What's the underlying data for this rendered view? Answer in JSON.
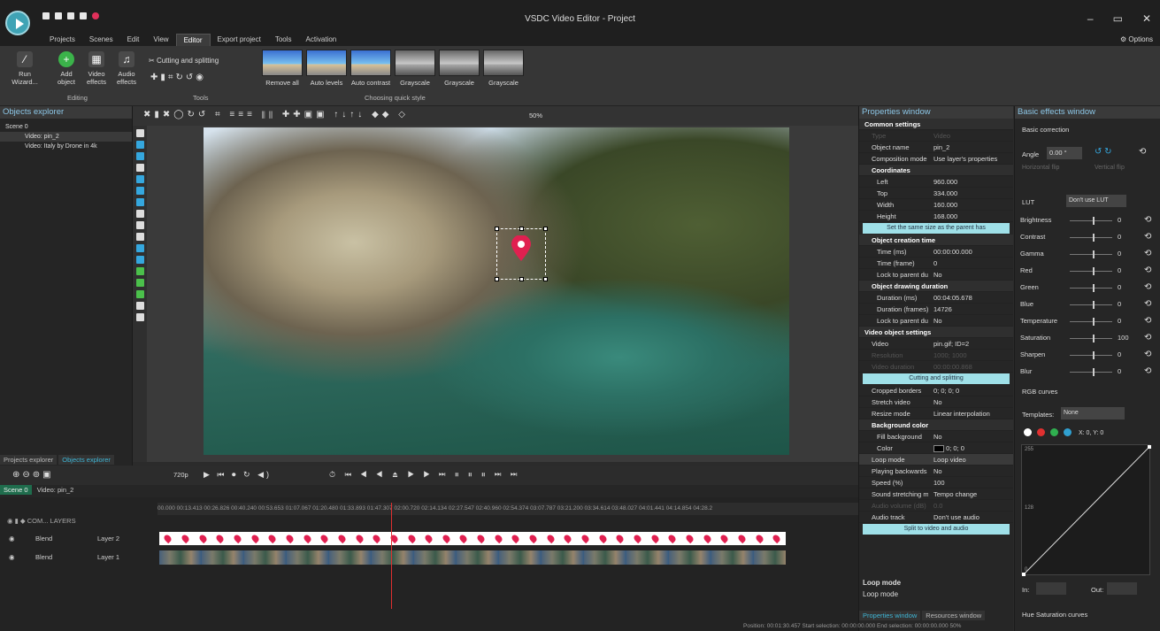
{
  "window": {
    "title": "VSDC Video Editor - Project",
    "options_label": "Options"
  },
  "menu": [
    "Projects",
    "Scenes",
    "Edit",
    "View",
    "Editor",
    "Export project",
    "Tools",
    "Activation"
  ],
  "ribbon": {
    "run_wizard": "Run Wizard...",
    "add_object": "Add object",
    "video_effects": "Video effects",
    "audio_effects": "Audio effects",
    "editing_label": "Editing",
    "cutting_label": "Cutting and splitting",
    "tools_label": "Tools",
    "quick_styles": [
      "Remove all",
      "Auto levels",
      "Auto contrast",
      "Grayscale",
      "Grayscale",
      "Grayscale"
    ],
    "quick_style_label": "Choosing quick style"
  },
  "objects_explorer": {
    "title": "Objects explorer",
    "items": [
      "Scene 0",
      "Video: pin_2",
      "Video: Italy by Drone in 4k"
    ],
    "tabs": [
      "Projects explorer",
      "Objects explorer"
    ]
  },
  "canvas": {
    "zoom": "50%"
  },
  "transport": {
    "resolution": "720p"
  },
  "timeline": {
    "tabs": [
      "Scene 0",
      "Video: pin_2"
    ],
    "header": "COM... LAYERS",
    "ruler": "00.000  00:13.413  00:26.826  00:40.240  00:53.653  01:07.067  01:20.480  01:33.893  01:47.307  02:00.720  02:14.134  02:27.547  02:40.960  02:54.374  03:07.787  03:21.200  03:34.614  03:48.027  04:01.441  04:14.854  04:28.2",
    "layers": [
      {
        "blend": "Blend",
        "name": "Layer 2"
      },
      {
        "blend": "Blend",
        "name": "Layer 1"
      }
    ],
    "pin_markers": 36
  },
  "properties": {
    "title": "Properties window",
    "common": "Common settings",
    "type_k": "Type",
    "type_v": "Video",
    "name_k": "Object name",
    "name_v": "pin_2",
    "comp_k": "Composition mode",
    "comp_v": "Use layer's properties",
    "coords": "Coordinates",
    "left_k": "Left",
    "left_v": "960.000",
    "top_k": "Top",
    "top_v": "334.000",
    "width_k": "Width",
    "width_v": "160.000",
    "height_k": "Height",
    "height_v": "168.000",
    "same_size_btn": "Set the same size as the parent has",
    "creation": "Object creation time",
    "time_ms_k": "Time (ms)",
    "time_ms_v": "00:00:00.000",
    "time_fr_k": "Time (frame)",
    "time_fr_v": "0",
    "lock1_k": "Lock to parent du",
    "lock1_v": "No",
    "drawing": "Object drawing duration",
    "dur_ms_k": "Duration (ms)",
    "dur_ms_v": "00:04:05.678",
    "dur_fr_k": "Duration (frames)",
    "dur_fr_v": "14726",
    "lock2_k": "Lock to parent du",
    "lock2_v": "No",
    "video_settings": "Video object settings",
    "video_k": "Video",
    "video_v": "pin.gif; ID=2",
    "res_k": "Resolution",
    "res_v": "1000; 1000",
    "vdur_k": "Video duration",
    "vdur_v": "00:00:00.868",
    "cut_btn": "Cutting and splitting",
    "crop_k": "Cropped borders",
    "crop_v": "0; 0; 0; 0",
    "stretch_k": "Stretch video",
    "stretch_v": "No",
    "resize_k": "Resize mode",
    "resize_v": "Linear interpolation",
    "bg": "Background color",
    "fill_k": "Fill background",
    "fill_v": "No",
    "color_k": "Color",
    "color_v": "0; 0; 0",
    "loop_k": "Loop mode",
    "loop_v": "Loop video",
    "back_k": "Playing backwards",
    "back_v": "No",
    "speed_k": "Speed (%)",
    "speed_v": "100",
    "sound_k": "Sound stretching m",
    "sound_v": "Tempo change",
    "avol_k": "Audio volume (dB)",
    "avol_v": "0.0",
    "atrack_k": "Audio track",
    "atrack_v": "Don't use audio",
    "split_btn": "Split to video and audio",
    "desc_title": "Loop mode",
    "desc_text": "Loop mode",
    "tabs": [
      "Properties window",
      "Resources window"
    ]
  },
  "effects": {
    "title": "Basic effects window",
    "basic": "Basic correction",
    "angle_label": "Angle",
    "angle_value": "0.00 °",
    "hflip": "Horizontal flip",
    "vflip": "Vertical flip",
    "lut_label": "LUT",
    "lut_value": "Don't use LUT",
    "sliders": [
      {
        "label": "Brightness",
        "value": "0"
      },
      {
        "label": "Contrast",
        "value": "0"
      },
      {
        "label": "Gamma",
        "value": "0"
      },
      {
        "label": "Red",
        "value": "0"
      },
      {
        "label": "Green",
        "value": "0"
      },
      {
        "label": "Blue",
        "value": "0"
      },
      {
        "label": "Temperature",
        "value": "0"
      },
      {
        "label": "Saturation",
        "value": "100"
      },
      {
        "label": "Sharpen",
        "value": "0"
      },
      {
        "label": "Blur",
        "value": "0"
      }
    ],
    "rgb_curves": "RGB curves",
    "templates_label": "Templates:",
    "templates_value": "None",
    "xy": "X: 0, Y: 0",
    "curve_top": "255",
    "curve_mid": "128",
    "curve_zero": "0",
    "in_label": "In:",
    "out_label": "Out:",
    "hue_curves": "Hue Saturation curves"
  },
  "status": {
    "text": "Position:   00:01:30.457   Start selection:   00:00:00.000   End selection:   00:00:00.000        50%"
  },
  "colors": {
    "accent": "#3fb6d6",
    "pin": "#e02050",
    "panel": "#262626"
  }
}
